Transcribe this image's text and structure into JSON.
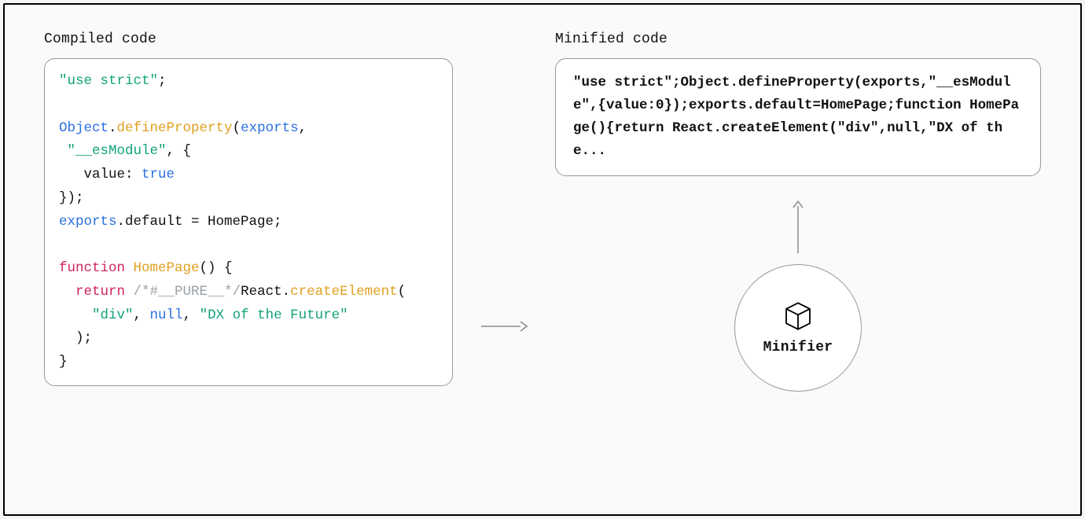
{
  "labels": {
    "left": "Compiled code",
    "right": "Minified code"
  },
  "node": {
    "title": "Minifier"
  },
  "compiled_code": {
    "tokens": [
      {
        "t": "\"use strict\"",
        "c": "s-str"
      },
      {
        "t": ";",
        "c": ""
      },
      {
        "t": "\n\n",
        "c": ""
      },
      {
        "t": "Object",
        "c": "s-obj"
      },
      {
        "t": ".",
        "c": ""
      },
      {
        "t": "defineProperty",
        "c": "s-fn"
      },
      {
        "t": "(",
        "c": ""
      },
      {
        "t": "exports",
        "c": "s-obj"
      },
      {
        "t": ",",
        "c": ""
      },
      {
        "t": "\n ",
        "c": ""
      },
      {
        "t": "\"__esModule\"",
        "c": "s-str"
      },
      {
        "t": ", {",
        "c": ""
      },
      {
        "t": "\n   ",
        "c": ""
      },
      {
        "t": "value: ",
        "c": ""
      },
      {
        "t": "true",
        "c": "s-bool"
      },
      {
        "t": "\n",
        "c": ""
      },
      {
        "t": "});",
        "c": ""
      },
      {
        "t": "\n",
        "c": ""
      },
      {
        "t": "exports",
        "c": "s-obj"
      },
      {
        "t": ".default = HomePage;",
        "c": ""
      },
      {
        "t": "\n\n",
        "c": ""
      },
      {
        "t": "function",
        "c": "s-kw"
      },
      {
        "t": " ",
        "c": ""
      },
      {
        "t": "HomePage",
        "c": "s-fn"
      },
      {
        "t": "() {",
        "c": ""
      },
      {
        "t": "\n  ",
        "c": ""
      },
      {
        "t": "return",
        "c": "s-kw"
      },
      {
        "t": " ",
        "c": ""
      },
      {
        "t": "/*#__PURE__*/",
        "c": "s-cmt"
      },
      {
        "t": "React.",
        "c": ""
      },
      {
        "t": "createElement",
        "c": "s-fn"
      },
      {
        "t": "(",
        "c": ""
      },
      {
        "t": "\n    ",
        "c": ""
      },
      {
        "t": "\"div\"",
        "c": "s-str"
      },
      {
        "t": ", ",
        "c": ""
      },
      {
        "t": "null",
        "c": "s-null"
      },
      {
        "t": ", ",
        "c": ""
      },
      {
        "t": "\"DX of the Future\"",
        "c": "s-str"
      },
      {
        "t": "\n  ",
        "c": ""
      },
      {
        "t": ");",
        "c": ""
      },
      {
        "t": "\n",
        "c": ""
      },
      {
        "t": "}",
        "c": ""
      }
    ]
  },
  "minified_code": {
    "text": "\"use strict\";Object.defineProperty(exports,\"__esModule\",{value:0});exports.default=HomePage;function HomePage(){return React.createElement(\"div\",null,\"DX of the..."
  }
}
